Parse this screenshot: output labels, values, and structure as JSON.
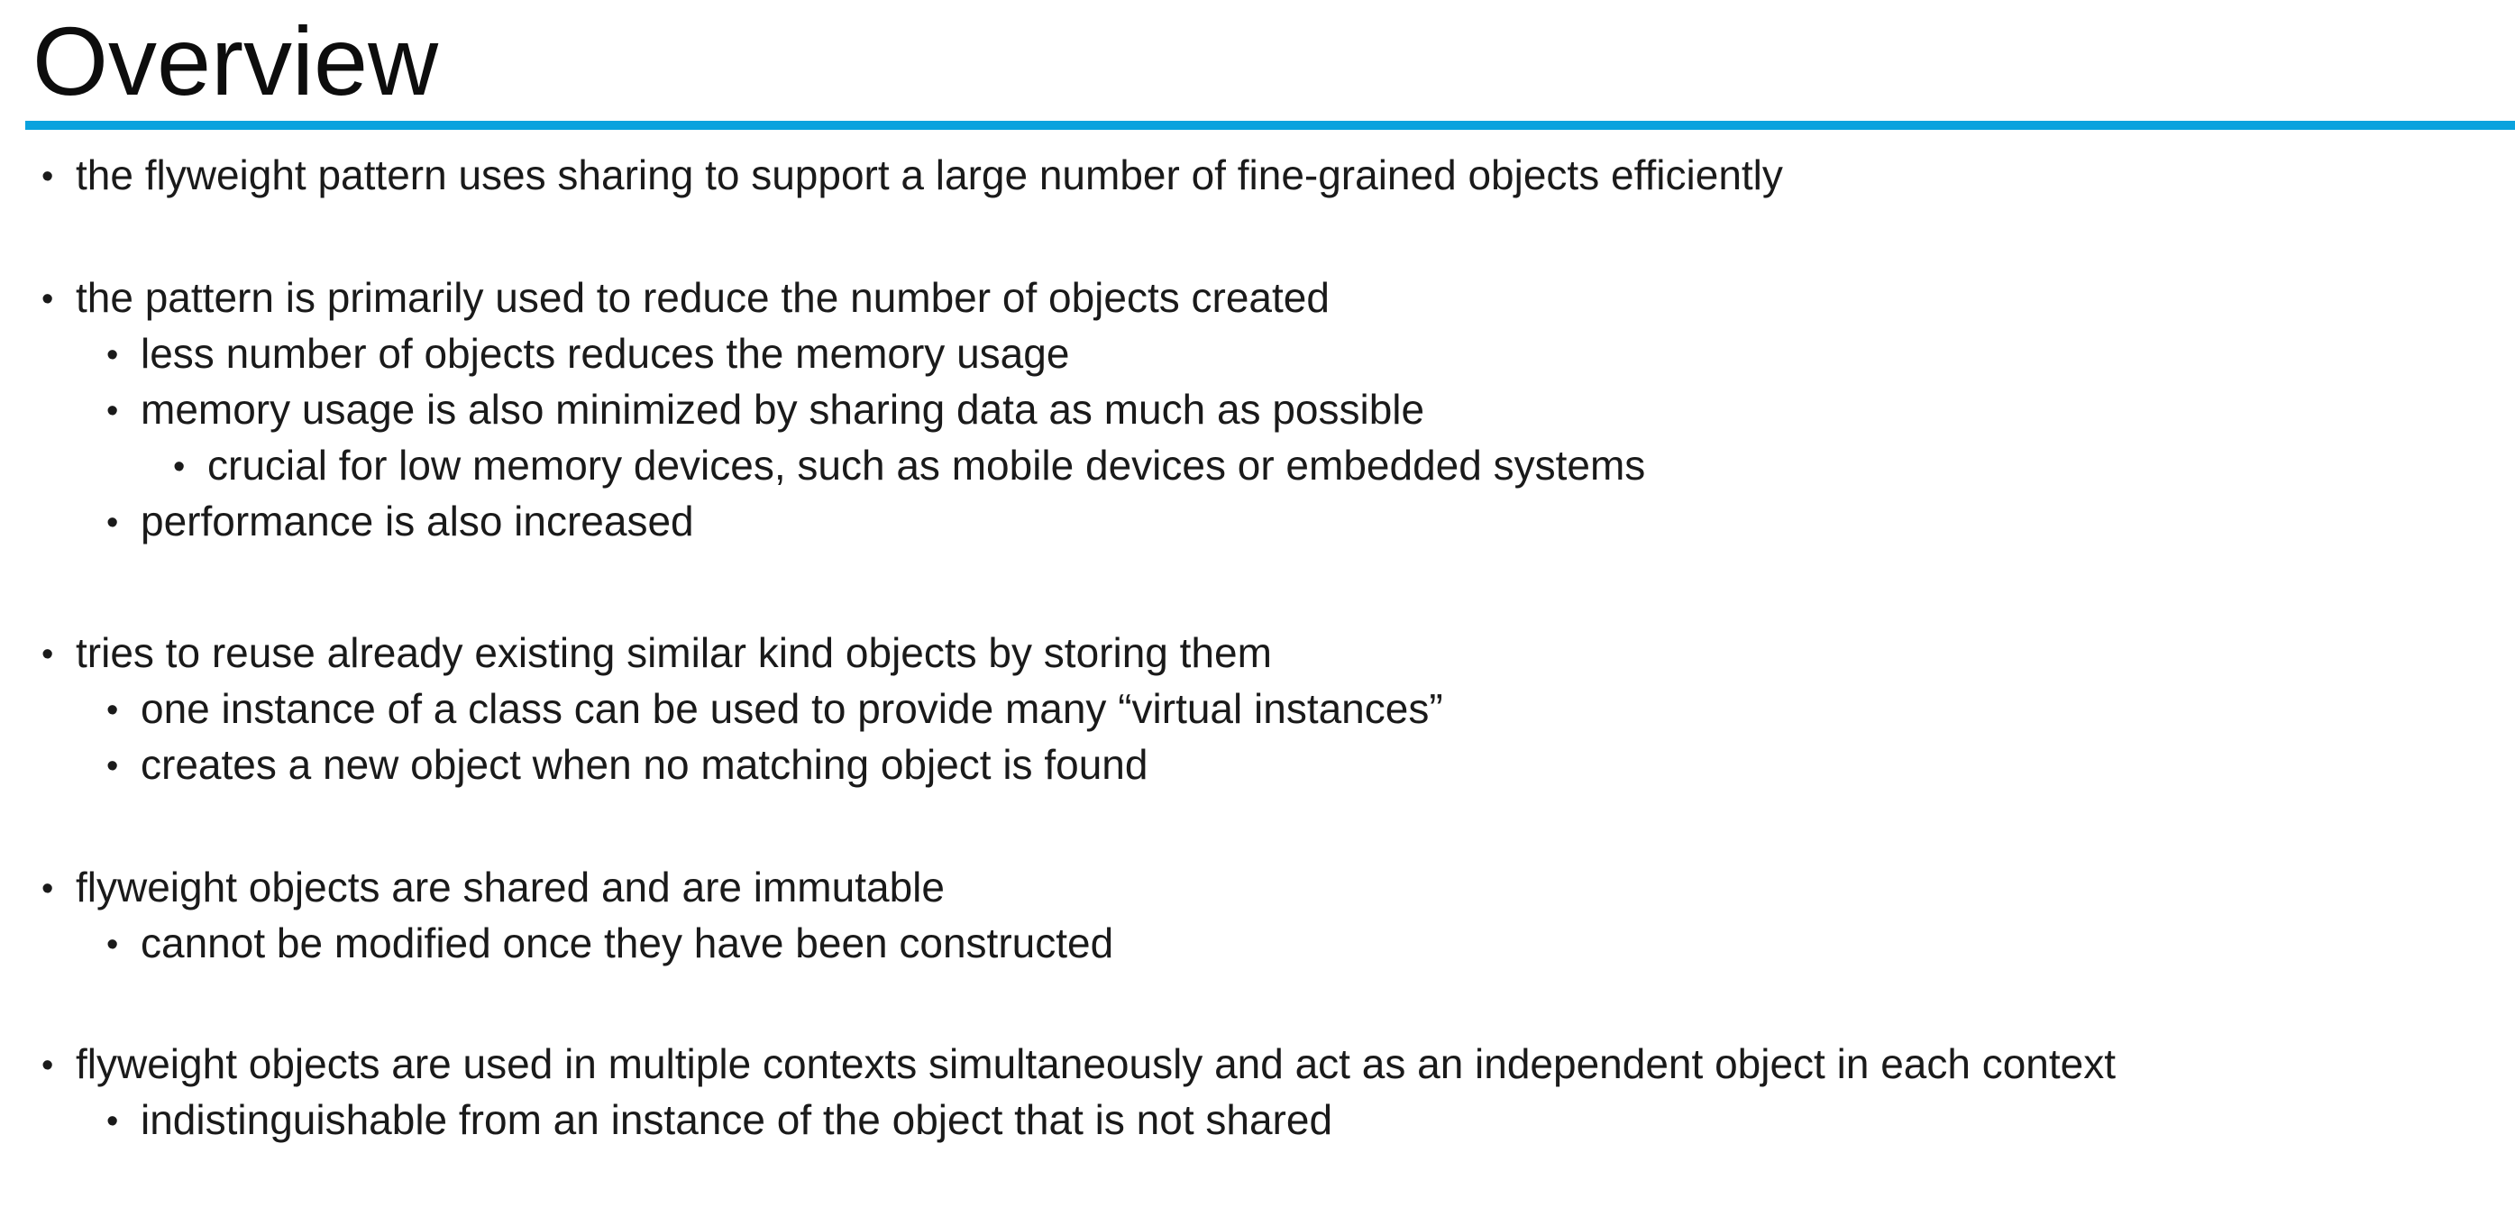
{
  "slide": {
    "title": "Overview",
    "accent_color": "#0aa2de",
    "bullet_glyph": "•",
    "items": [
      {
        "level": 1,
        "text": "the flyweight pattern uses sharing to support a large number of fine-grained objects efficiently"
      },
      {
        "level": 1,
        "text": "the pattern is primarily used to reduce the number of objects created"
      },
      {
        "level": 2,
        "text": "less number of objects reduces the memory usage"
      },
      {
        "level": 2,
        "text": "memory usage is also minimized by sharing data as much as possible"
      },
      {
        "level": 3,
        "text": "crucial for low memory devices, such as mobile devices or embedded systems"
      },
      {
        "level": 2,
        "text": "performance is also increased"
      },
      {
        "level": 1,
        "text": "tries to reuse already existing similar kind objects by storing them"
      },
      {
        "level": 2,
        "text": "one instance of a class can be used to provide many “virtual instances”"
      },
      {
        "level": 2,
        "text": "creates a new object when no matching object is found"
      },
      {
        "level": 1,
        "text": "flyweight objects are shared and are immutable"
      },
      {
        "level": 2,
        "text": "cannot be modified once they have been constructed"
      },
      {
        "level": 1,
        "text": "flyweight objects are used in multiple contexts simultaneously and act as an independent object in each context"
      },
      {
        "level": 2,
        "text": "indistinguishable from an instance of the object that is not shared"
      }
    ]
  }
}
